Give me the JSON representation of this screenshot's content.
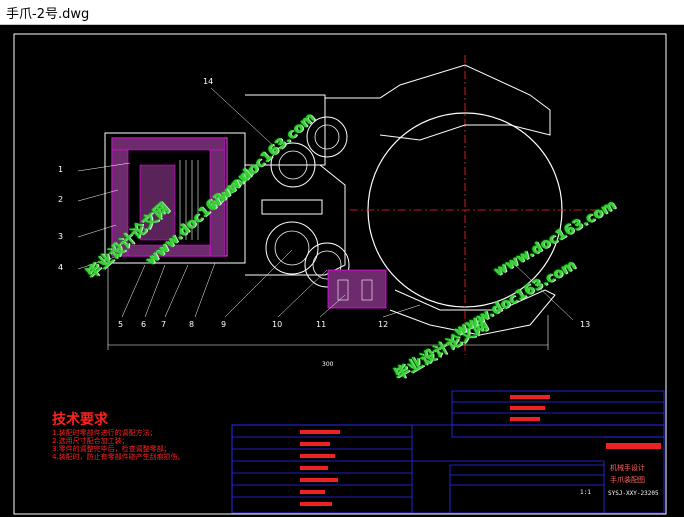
{
  "window": {
    "title": "手爪-2号.dwg"
  },
  "drawing": {
    "callouts": [
      "1",
      "2",
      "3",
      "4",
      "5",
      "6",
      "7",
      "8",
      "9",
      "10",
      "11",
      "12",
      "13",
      "14"
    ],
    "dimension_label": "300",
    "tech_requirements": {
      "heading": "技术要求",
      "lines": [
        "1.装配时零部件进行的调配方法；",
        "2.选用尺寸配合加工装；",
        "3.零件的调整完毕后，检查调整零部；",
        "4.装配时，防止有零部件碰产生刮痕损伤。"
      ]
    },
    "watermarks": [
      "毕业设计论文网",
      "www.doc163.com"
    ],
    "title_block": {
      "project": "机械手设计",
      "drawing_name": "手爪装配图",
      "code": "SYSJ-XXY-23205",
      "scale": "1:1"
    }
  },
  "colors": {
    "frame": "#ffffff",
    "hatch": "#ff00ff",
    "center": "#ff0000",
    "table": "#0000ff",
    "watermark": "#35d335"
  }
}
